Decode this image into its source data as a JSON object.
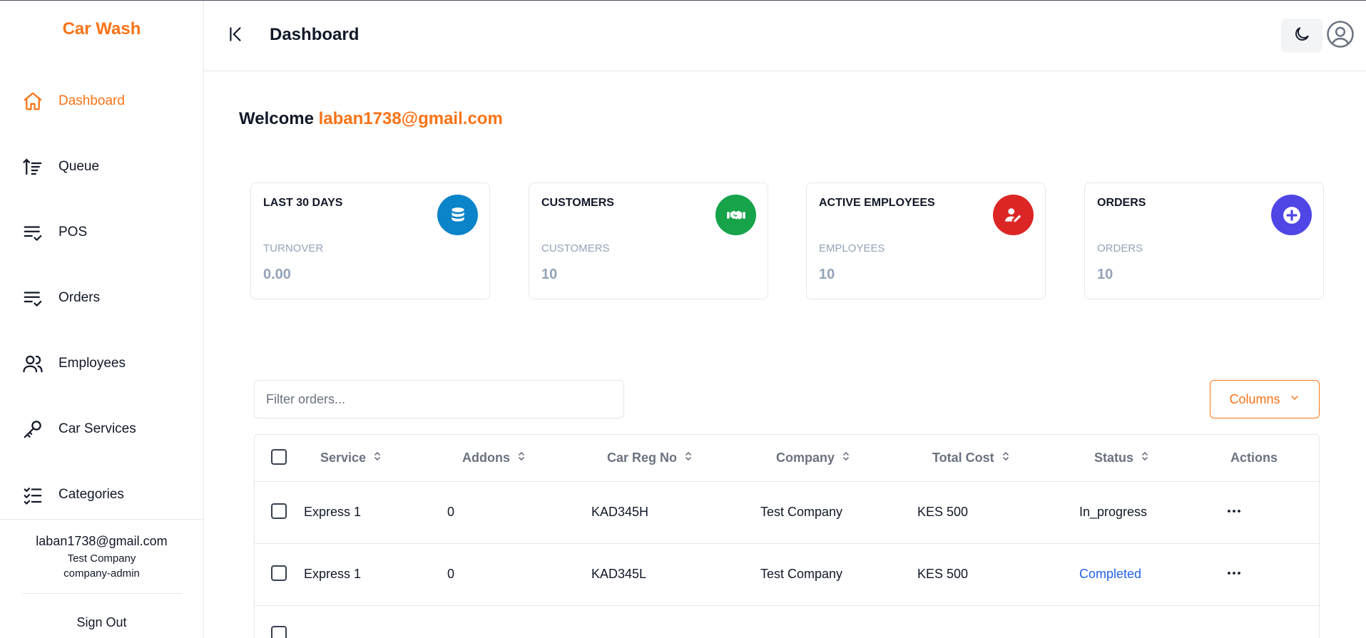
{
  "brand": "Car Wash",
  "sidebar": {
    "items": [
      {
        "label": "Dashboard",
        "icon": "home-icon",
        "active": true
      },
      {
        "label": "Queue",
        "icon": "sort-ascending-icon"
      },
      {
        "label": "POS",
        "icon": "list-check-icon"
      },
      {
        "label": "Orders",
        "icon": "list-check-icon"
      },
      {
        "label": "Employees",
        "icon": "users-icon"
      },
      {
        "label": "Car Services",
        "icon": "key-icon"
      },
      {
        "label": "Categories",
        "icon": "checklist-icon"
      }
    ],
    "user": {
      "email": "laban1738@gmail.com",
      "company": "Test Company",
      "role": "company-admin"
    },
    "sign_out": "Sign Out"
  },
  "header": {
    "title": "Dashboard",
    "collapse_icon": "collapse-left-icon",
    "theme_icon": "moon-icon",
    "avatar_icon": "user-circle-icon"
  },
  "welcome": {
    "prefix": "Welcome",
    "email": "laban1738@gmail.com"
  },
  "cards": [
    {
      "title": "LAST 30 DAYS",
      "subtitle": "TURNOVER",
      "value": "0.00",
      "icon": "database-icon",
      "color": "#0b84c9"
    },
    {
      "title": "CUSTOMERS",
      "subtitle": "CUSTOMERS",
      "value": "10",
      "icon": "handshake-icon",
      "color": "#16a34a"
    },
    {
      "title": "ACTIVE EMPLOYEES",
      "subtitle": "EMPLOYEES",
      "value": "10",
      "icon": "user-edit-icon",
      "color": "#dc2626"
    },
    {
      "title": "ORDERS",
      "subtitle": "ORDERS",
      "value": "10",
      "icon": "plus-circle-icon",
      "color": "#4f46e5"
    }
  ],
  "filter": {
    "placeholder": "Filter orders..."
  },
  "columns_button": "Columns",
  "table": {
    "headers": [
      "Service",
      "Addons",
      "Car Reg No",
      "Company",
      "Total Cost",
      "Status",
      "Actions"
    ],
    "rows": [
      {
        "service": "Express 1",
        "addons": "0",
        "car_reg": "KAD345H",
        "company": "Test Company",
        "total_cost": "KES 500",
        "status": "In_progress"
      },
      {
        "service": "Express 1",
        "addons": "0",
        "car_reg": "KAD345L",
        "company": "Test Company",
        "total_cost": "KES 500",
        "status": "Completed"
      }
    ]
  },
  "colors": {
    "accent": "#f97316",
    "completed": "#2563eb"
  }
}
